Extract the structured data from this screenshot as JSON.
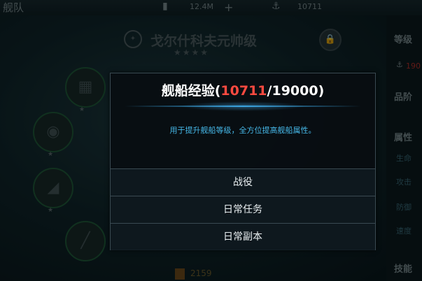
{
  "background": {
    "top_title": "舰队",
    "resource_1": "12.4M",
    "resource_2": "10711",
    "add_symbol": "+",
    "ship_name": "戈尔什科夫元帅级",
    "stars": "★★★★",
    "right_panel": {
      "level_label": "等级",
      "level_value": "190",
      "category_label": "品阶",
      "attribute_label": "属性",
      "attr_1": "生命",
      "attr_2": "攻击",
      "attr_3": "防御",
      "attr_4": "速度",
      "skill_label": "技能"
    },
    "bottom_value": "2159"
  },
  "dialog": {
    "title_prefix": "舰船经验(",
    "current_exp": "10711",
    "title_separator": "/",
    "max_exp": "19000",
    "title_suffix": ")",
    "description": "用于提升舰船等级，全方位提高舰船属性。",
    "options": [
      {
        "label": "战役"
      },
      {
        "label": "日常任务"
      },
      {
        "label": "日常副本"
      }
    ]
  },
  "colors": {
    "current_exp": "#ff4a40",
    "description": "#46b8e8",
    "title_line": "#3aa4e0"
  }
}
